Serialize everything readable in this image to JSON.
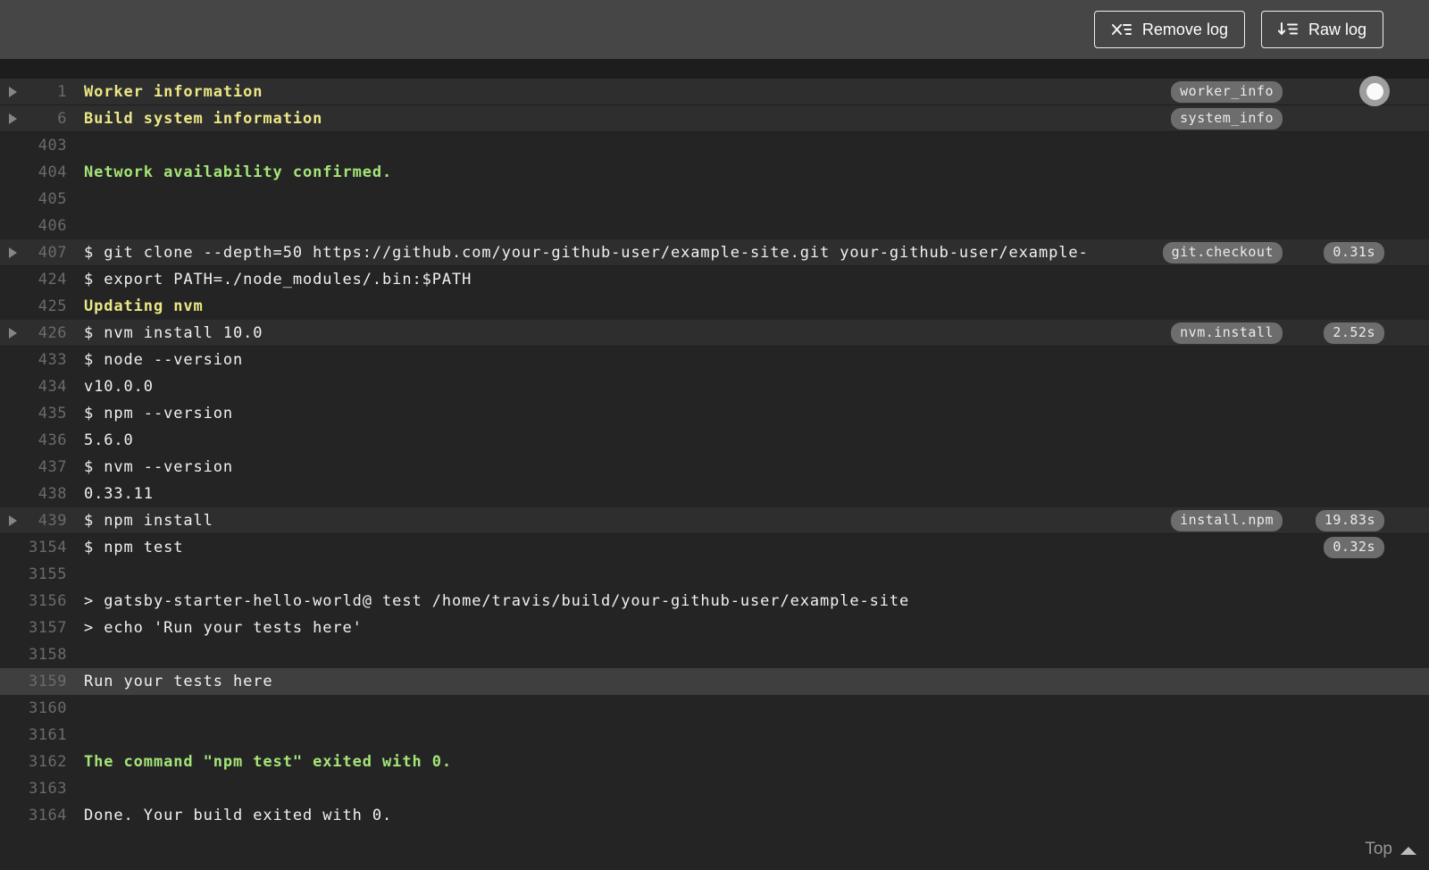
{
  "toolbar": {
    "buttons": [
      {
        "label": "Remove log",
        "icon": "remove-log-icon"
      },
      {
        "label": "Raw log",
        "icon": "raw-log-icon"
      }
    ]
  },
  "log": {
    "lines": [
      {
        "num": "1",
        "text": "Worker information",
        "style": "yellow",
        "fold": true,
        "badge": "worker_info"
      },
      {
        "num": "6",
        "text": "Build system information",
        "style": "yellow",
        "fold": true,
        "badge": "system_info"
      },
      {
        "num": "403",
        "text": ""
      },
      {
        "num": "404",
        "text": "Network availability confirmed.",
        "style": "green"
      },
      {
        "num": "405",
        "text": ""
      },
      {
        "num": "406",
        "text": ""
      },
      {
        "num": "407",
        "text": "$ git clone --depth=50 https://github.com/your-github-user/example-site.git your-github-user/example-",
        "fold": true,
        "badge": "git.checkout",
        "time": "0.31s"
      },
      {
        "num": "424",
        "text": "$ export PATH=./node_modules/.bin:$PATH"
      },
      {
        "num": "425",
        "text": "Updating nvm",
        "style": "yellow"
      },
      {
        "num": "426",
        "text": "$ nvm install 10.0",
        "fold": true,
        "badge": "nvm.install",
        "time": "2.52s"
      },
      {
        "num": "433",
        "text": "$ node --version"
      },
      {
        "num": "434",
        "text": "v10.0.0"
      },
      {
        "num": "435",
        "text": "$ npm --version"
      },
      {
        "num": "436",
        "text": "5.6.0"
      },
      {
        "num": "437",
        "text": "$ nvm --version"
      },
      {
        "num": "438",
        "text": "0.33.11"
      },
      {
        "num": "439",
        "text": "$ npm install",
        "fold": true,
        "badge": "install.npm",
        "time": "19.83s"
      },
      {
        "num": "3154",
        "text": "$ npm test",
        "time": "0.32s"
      },
      {
        "num": "3155",
        "text": ""
      },
      {
        "num": "3156",
        "text": "> gatsby-starter-hello-world@ test /home/travis/build/your-github-user/example-site"
      },
      {
        "num": "3157",
        "text": "> echo 'Run your tests here'"
      },
      {
        "num": "3158",
        "text": ""
      },
      {
        "num": "3159",
        "text": "Run your tests here",
        "highlight": true
      },
      {
        "num": "3160",
        "text": ""
      },
      {
        "num": "3161",
        "text": ""
      },
      {
        "num": "3162",
        "text": "The command \"npm test\" exited with 0.",
        "style": "green"
      },
      {
        "num": "3163",
        "text": ""
      },
      {
        "num": "3164",
        "text": "Done. Your build exited with 0."
      }
    ]
  },
  "footer": {
    "top_label": "Top"
  },
  "icons": {
    "follow_log": "follow-log-toggle",
    "fold": "fold-arrow-icon",
    "top": "scroll-top-arrow-icon"
  },
  "colors": {
    "header_bg": "#464646",
    "page_bg": "#1d1d1d",
    "log_bg": "#242424",
    "fold_row_bg": "#2e2e2e",
    "highlight_row_bg": "#3f3f3f",
    "text": "#f1f1f1",
    "line_number": "#6b6b6b",
    "yellow": "#ece786",
    "green": "#a5e578",
    "badge_bg": "#6d6d6d"
  }
}
